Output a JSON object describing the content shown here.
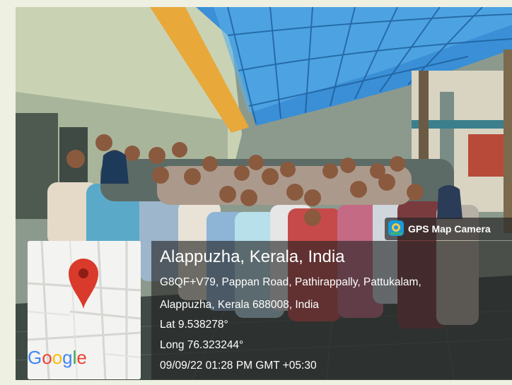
{
  "overlay": {
    "badge_label": "GPS Map Camera",
    "location_title": "Alappuzha, Kerala, India",
    "address_line1": "G8QF+V79, Pappan Road, Pathirappally, Pattukalam,",
    "address_line2": "Alappuzha, Kerala 688008, India",
    "latitude": "Lat 9.538278°",
    "longitude": "Long 76.323244°",
    "timestamp": "09/09/22 01:28 PM GMT +05:30"
  },
  "map": {
    "logo": "Google",
    "pin_color": "#d93a2b",
    "icon": "map-pin-icon"
  },
  "colors": {
    "canopy": "#3a8fd6",
    "canopy_frame": "#e8a83a",
    "panel": "#222222"
  }
}
